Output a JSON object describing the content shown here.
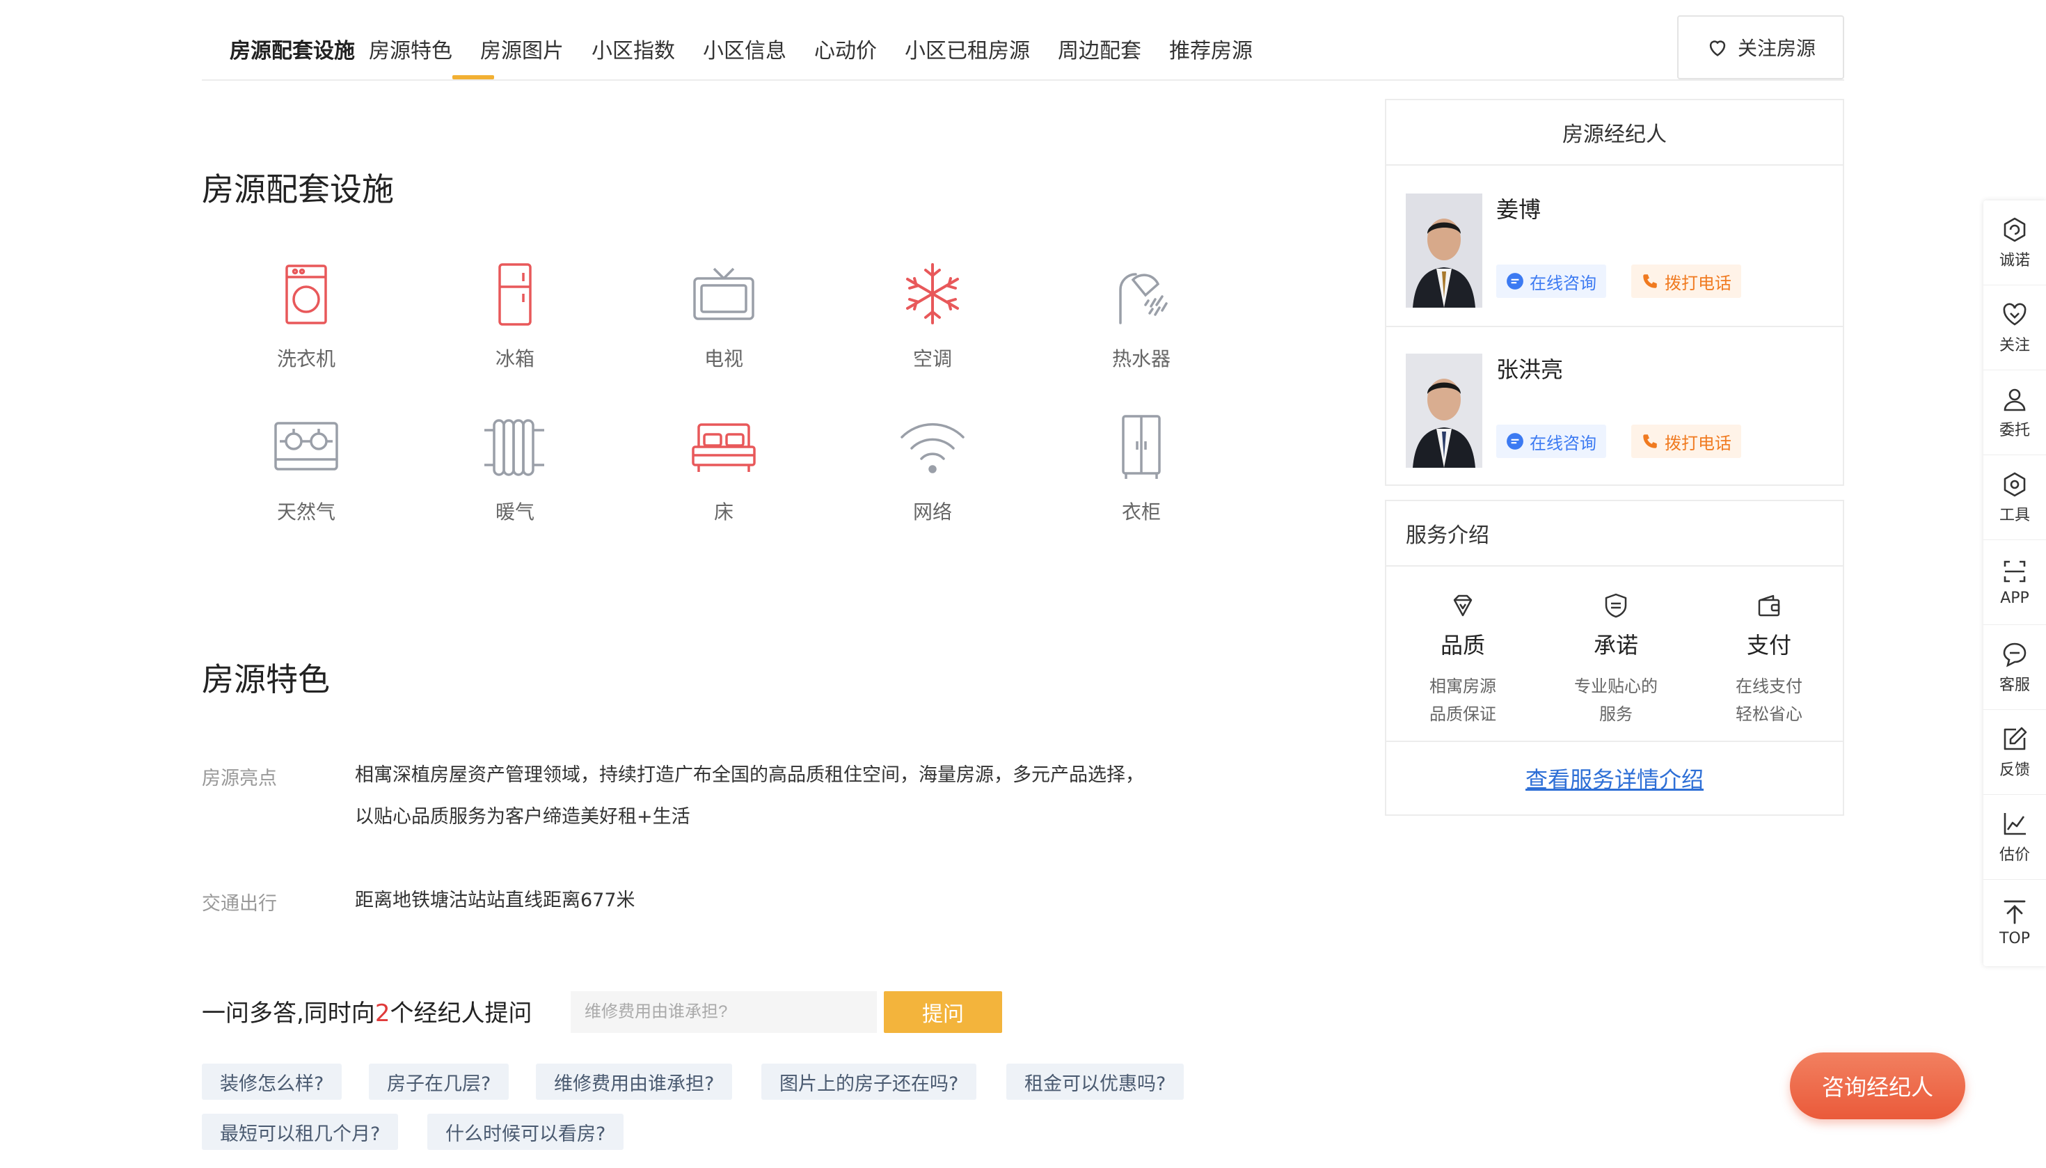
{
  "tabs": [
    {
      "label": "房源配套设施",
      "active": true
    },
    {
      "label": "房源特色"
    },
    {
      "label": "房源图片"
    },
    {
      "label": "小区指数"
    },
    {
      "label": "小区信息"
    },
    {
      "label": "心动价"
    },
    {
      "label": "小区已租房源"
    },
    {
      "label": "周边配套"
    },
    {
      "label": "推荐房源"
    }
  ],
  "follow_button": {
    "label": "关注房源",
    "icon": "heart-outline-icon"
  },
  "facilities": {
    "title": "房源配套设施",
    "items": [
      {
        "label": "洗衣机",
        "icon": "washing-machine-icon",
        "available": true
      },
      {
        "label": "冰箱",
        "icon": "fridge-icon",
        "available": true
      },
      {
        "label": "电视",
        "icon": "tv-icon",
        "available": false
      },
      {
        "label": "空调",
        "icon": "air-conditioner-icon",
        "available": true
      },
      {
        "label": "热水器",
        "icon": "water-heater-icon",
        "available": false
      },
      {
        "label": "天然气",
        "icon": "gas-stove-icon",
        "available": false
      },
      {
        "label": "暖气",
        "icon": "radiator-icon",
        "available": false
      },
      {
        "label": "床",
        "icon": "bed-icon",
        "available": true
      },
      {
        "label": "网络",
        "icon": "wifi-icon",
        "available": false
      },
      {
        "label": "衣柜",
        "icon": "wardrobe-icon",
        "available": false
      }
    ],
    "colors": {
      "available": "#e8585a",
      "unavailable": "#9a9fa8"
    }
  },
  "features": {
    "title": "房源特色",
    "rows": [
      {
        "key": "房源亮点",
        "value": "相寓深植房屋资产管理领域，持续打造广布全国的高品质租住空间，海量房源，多元产品选择，以贴心品质服务为客户缔造美好租+生活"
      },
      {
        "key": "交通出行",
        "value": "距离地铁塘沽站站直线距离677米"
      }
    ]
  },
  "qa": {
    "title_prefix": "一问多答,同时向",
    "title_count": "2",
    "title_suffix": "个经纪人提问",
    "input_placeholder": "维修费用由谁承担?",
    "submit_label": "提问",
    "chips": [
      "装修怎么样?",
      "房子在几层?",
      "维修费用由谁承担?",
      "图片上的房子还在吗?",
      "租金可以优惠吗?",
      "最短可以租几个月?",
      "什么时候可以看房?"
    ]
  },
  "agents_card": {
    "title": "房源经纪人",
    "agents": [
      {
        "name": "姜博",
        "chat_label": "在线咨询",
        "call_label": "拨打电话"
      },
      {
        "name": "张洪亮",
        "chat_label": "在线咨询",
        "call_label": "拨打电话"
      }
    ]
  },
  "service_card": {
    "title": "服务介绍",
    "items": [
      {
        "title": "品质",
        "desc": "相寓房源\n品质保证",
        "icon": "diamond-icon"
      },
      {
        "title": "承诺",
        "desc": "专业贴心的\n服务",
        "icon": "shield-icon"
      },
      {
        "title": "支付",
        "desc": "在线支付\n轻松省心",
        "icon": "wallet-icon"
      }
    ],
    "link_label": "查看服务详情介绍"
  },
  "toolbar": [
    {
      "label": "诚诺",
      "icon": "promise-icon"
    },
    {
      "label": "关注",
      "icon": "heart-icon"
    },
    {
      "label": "委托",
      "icon": "user-icon"
    },
    {
      "label": "工具",
      "icon": "tool-icon"
    },
    {
      "label": "APP",
      "icon": "scan-icon"
    },
    {
      "label": "客服",
      "icon": "chat-bubble-icon"
    },
    {
      "label": "反馈",
      "icon": "edit-icon"
    },
    {
      "label": "估价",
      "icon": "chart-line-icon"
    },
    {
      "label": "TOP",
      "icon": "arrow-up-icon"
    }
  ],
  "consult_button": {
    "label": "咨询经纪人"
  },
  "colors": {
    "accent": "#f2b033",
    "link": "#2e6fd6",
    "consult": "#ea5a3a",
    "highlight": "#e03a3a"
  }
}
